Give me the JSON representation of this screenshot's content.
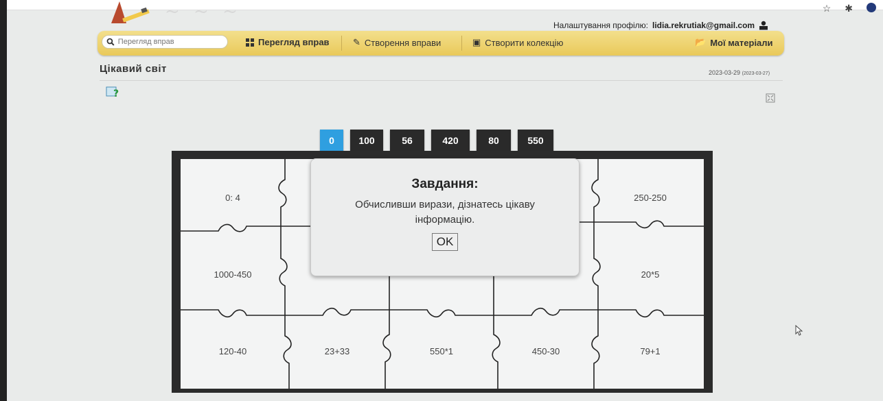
{
  "profile": {
    "label": "Налаштування профілю:",
    "email": "lidia.rekrutiak@gmail.com",
    "icon": "user-icon"
  },
  "toolbar": {
    "search_placeholder": "Перегляд вправ",
    "view_exercises": "Перегляд вправ",
    "create_exercise": "Створення вправи",
    "create_collection": "Створити колекцію",
    "my_materials": "Мої матеріали",
    "colors": {
      "bar": "#e9c95a"
    }
  },
  "page": {
    "title": "Цікавий світ",
    "date": "2023-03-29",
    "date_small": "(2023-03-27)"
  },
  "answers": [
    "0",
    "100",
    "56",
    "420",
    "80",
    "550"
  ],
  "active_answer": "0",
  "puzzle": {
    "cells": [
      "0: 4",
      "",
      "",
      "",
      "250-250",
      "1000-450",
      "",
      "",
      "",
      "20*5",
      "120-40",
      "23+33",
      "550*1",
      "450-30",
      "79+1"
    ]
  },
  "modal": {
    "title": "Завдання:",
    "text": "Обчисливши вирази, дізнатесь цікаву інформацію.",
    "ok": "OK"
  },
  "colors": {
    "active_tile": "#2f9fe0",
    "tile": "#2a2a2a",
    "frame": "#2b2b2b"
  }
}
